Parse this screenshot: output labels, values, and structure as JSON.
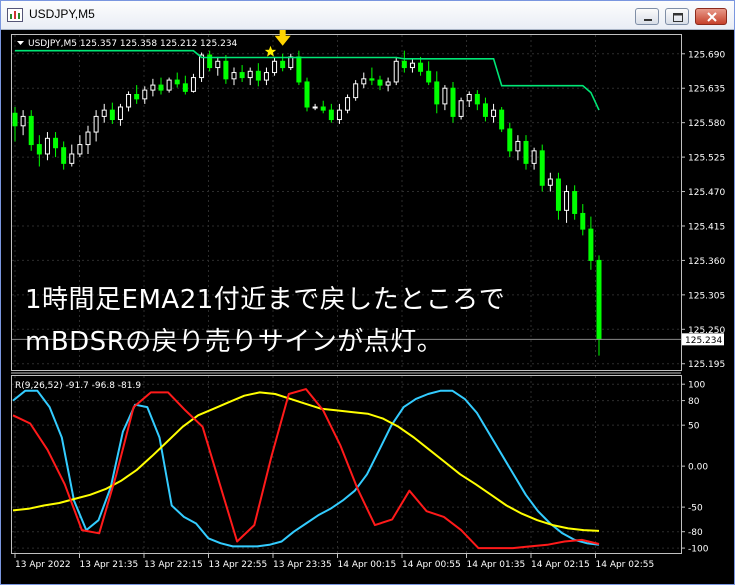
{
  "window": {
    "title": "USDJPY,M5"
  },
  "main_chart": {
    "header": "USDJPY,M5  125.357 125.358 125.212 125.234",
    "price_label": "125.234",
    "annotation_lines": [
      "1時間足EMA21付近まで戻したところで",
      "mBDSRの戻り売りサインが点灯。"
    ]
  },
  "indicator": {
    "header": "R(9,26,52) -91.7 -96.8 -81.9"
  },
  "time_labels": [
    "13 Apr 2022",
    "13 Apr 21:35",
    "13 Apr 22:15",
    "13 Apr 22:55",
    "13 Apr 23:35",
    "14 Apr 00:15",
    "14 Apr 00:55",
    "14 Apr 01:35",
    "14 Apr 02:15",
    "14 Apr 02:55"
  ],
  "colors": {
    "background": "#000000",
    "grid": "#2d2d2d",
    "bull": "#ffffff",
    "bear": "#00ff00",
    "ema": "#00e676",
    "signal_arrow": "#ffd400",
    "signal_star": "#ffee00",
    "r_fast": "#ff1a1a",
    "r_mid": "#33ccff",
    "r_slow": "#ffff00"
  },
  "chart_data": [
    {
      "type": "candlestick",
      "title": "USDJPY,M5",
      "y_ticks": [
        125.69,
        125.635,
        125.58,
        125.525,
        125.47,
        125.415,
        125.36,
        125.305,
        125.25,
        125.195
      ],
      "ylim": [
        125.185,
        125.72
      ],
      "last_price": 125.234,
      "candles": [
        [
          125.595,
          125.605,
          125.55,
          125.575
        ],
        [
          125.575,
          125.6,
          125.56,
          125.59
        ],
        [
          125.59,
          125.6,
          125.535,
          125.545
        ],
        [
          125.545,
          125.56,
          125.51,
          125.53
        ],
        [
          125.53,
          125.565,
          125.52,
          125.555
        ],
        [
          125.555,
          125.565,
          125.525,
          125.54
        ],
        [
          125.54,
          125.55,
          125.505,
          125.515
        ],
        [
          125.515,
          125.545,
          125.51,
          125.53
        ],
        [
          125.53,
          125.56,
          125.525,
          125.545
        ],
        [
          125.545,
          125.575,
          125.53,
          125.565
        ],
        [
          125.565,
          125.6,
          125.55,
          125.59
        ],
        [
          125.59,
          125.61,
          125.58,
          125.6
        ],
        [
          125.6,
          125.612,
          125.578,
          125.585
        ],
        [
          125.585,
          125.61,
          125.575,
          125.605
        ],
        [
          125.605,
          125.63,
          125.598,
          125.625
        ],
        [
          125.625,
          125.64,
          125.61,
          125.618
        ],
        [
          125.618,
          125.638,
          125.61,
          125.632
        ],
        [
          125.632,
          125.65,
          125.622,
          125.64
        ],
        [
          125.64,
          125.652,
          125.625,
          125.632
        ],
        [
          125.632,
          125.652,
          125.628,
          125.648
        ],
        [
          125.648,
          125.66,
          125.636,
          125.642
        ],
        [
          125.642,
          125.655,
          125.625,
          125.63
        ],
        [
          125.63,
          125.658,
          125.628,
          125.652
        ],
        [
          125.652,
          125.692,
          125.645,
          125.688
        ],
        [
          125.688,
          125.695,
          125.662,
          125.668
        ],
        [
          125.668,
          125.685,
          125.655,
          125.678
        ],
        [
          125.678,
          125.688,
          125.642,
          125.65
        ],
        [
          125.65,
          125.668,
          125.64,
          125.66
        ],
        [
          125.66,
          125.672,
          125.645,
          125.652
        ],
        [
          125.652,
          125.668,
          125.64,
          125.662
        ],
        [
          125.662,
          125.675,
          125.638,
          125.648
        ],
        [
          125.648,
          125.668,
          125.64,
          125.66
        ],
        [
          125.66,
          125.685,
          125.655,
          125.678
        ],
        [
          125.678,
          125.69,
          125.662,
          125.668
        ],
        [
          125.668,
          125.69,
          125.664,
          125.685
        ],
        [
          125.685,
          125.695,
          125.64,
          125.645
        ],
        [
          125.645,
          125.652,
          125.598,
          125.605
        ],
        [
          125.605,
          125.61,
          125.6,
          125.605
        ],
        [
          125.605,
          125.615,
          125.595,
          125.6
        ],
        [
          125.6,
          125.61,
          125.58,
          125.585
        ],
        [
          125.585,
          125.61,
          125.578,
          125.6
        ],
        [
          125.6,
          125.625,
          125.595,
          125.62
        ],
        [
          125.62,
          125.648,
          125.615,
          125.642
        ],
        [
          125.642,
          125.66,
          125.635,
          125.65
        ],
        [
          125.65,
          125.668,
          125.64,
          125.648
        ],
        [
          125.648,
          125.655,
          125.632,
          125.64
        ],
        [
          125.64,
          125.652,
          125.63,
          125.645
        ],
        [
          125.645,
          125.685,
          125.64,
          125.678
        ],
        [
          125.678,
          125.695,
          125.66,
          125.668
        ],
        [
          125.668,
          125.682,
          125.66,
          125.675
        ],
        [
          125.675,
          125.685,
          125.655,
          125.662
        ],
        [
          125.662,
          125.678,
          125.64,
          125.645
        ],
        [
          125.645,
          125.662,
          125.595,
          125.61
        ],
        [
          125.61,
          125.64,
          125.6,
          125.635
        ],
        [
          125.635,
          125.645,
          125.58,
          125.59
        ],
        [
          125.59,
          125.62,
          125.585,
          125.615
        ],
        [
          125.615,
          125.63,
          125.605,
          125.625
        ],
        [
          125.625,
          125.632,
          125.6,
          125.61
        ],
        [
          125.61,
          125.62,
          125.582,
          125.59
        ],
        [
          125.59,
          125.61,
          125.58,
          125.6
        ],
        [
          125.6,
          125.605,
          125.565,
          125.57
        ],
        [
          125.57,
          125.58,
          125.525,
          125.535
        ],
        [
          125.535,
          125.56,
          125.52,
          125.55
        ],
        [
          125.55,
          125.56,
          125.505,
          125.515
        ],
        [
          125.515,
          125.54,
          125.505,
          125.535
        ],
        [
          125.535,
          125.545,
          125.47,
          125.48
        ],
        [
          125.48,
          125.5,
          125.47,
          125.49
        ],
        [
          125.49,
          125.5,
          125.425,
          125.44
        ],
        [
          125.44,
          125.48,
          125.42,
          125.47
        ],
        [
          125.47,
          125.48,
          125.425,
          125.435
        ],
        [
          125.435,
          125.45,
          125.4,
          125.41
        ],
        [
          125.41,
          125.43,
          125.345,
          125.36
        ],
        [
          125.36,
          125.368,
          125.208,
          125.234
        ]
      ],
      "series": [
        {
          "name": "",
          "values": [
            125.695,
            125.695,
            125.695,
            125.695,
            125.695,
            125.695,
            125.695,
            125.695,
            125.695,
            125.695,
            125.695,
            125.695,
            125.695,
            125.695,
            125.695,
            125.695,
            125.695,
            125.695,
            125.695,
            125.695,
            125.695,
            125.695,
            125.695,
            125.684,
            125.684,
            125.684,
            125.684,
            125.684,
            125.684,
            125.684,
            125.684,
            125.684,
            125.684,
            125.684,
            125.684,
            125.684,
            125.684,
            125.684,
            125.684,
            125.684,
            125.684,
            125.684,
            125.684,
            125.684,
            125.684,
            125.684,
            125.684,
            125.684,
            125.682,
            125.682,
            125.682,
            125.682,
            125.682,
            125.682,
            125.682,
            125.682,
            125.682,
            125.682,
            125.682,
            125.682,
            125.639,
            125.639,
            125.639,
            125.639,
            125.639,
            125.639,
            125.639,
            125.639,
            125.639,
            125.639,
            125.639,
            125.628,
            125.6
          ]
        }
      ],
      "signal_index": 33
    },
    {
      "type": "line",
      "title": "R(9,26,52) -91.7 -96.8 -81.9",
      "y_ticks": [
        100,
        80,
        50,
        0,
        -50,
        -80,
        -100
      ],
      "y_tick_labels": [
        "100",
        "80",
        "50",
        "0.00",
        "-50",
        "-80",
        "-100"
      ],
      "ylim": [
        -106,
        110
      ],
      "series": [
        {
          "name": "",
          "values": [
            80,
            92,
            92,
            72,
            35,
            -42,
            -78,
            -66,
            -26,
            42,
            75,
            72,
            35,
            -48,
            -62,
            -70,
            -88,
            -94,
            -98,
            -98,
            -98,
            -96,
            -92,
            -80,
            -70,
            -60,
            -52,
            -42,
            -30,
            -10,
            20,
            50,
            72,
            82,
            88,
            92,
            92,
            82,
            65,
            40,
            15,
            -10,
            -35,
            -55,
            -70,
            -82,
            -90,
            -94,
            -96
          ]
        },
        {
          "name": "",
          "values": [
            62,
            52,
            20,
            -22,
            -78,
            -82,
            -10,
            72,
            90,
            90,
            68,
            48,
            -22,
            -92,
            -72,
            12,
            88,
            94,
            68,
            25,
            -28,
            -72,
            -65,
            -30,
            -55,
            -62,
            -78,
            -100,
            -100,
            -100,
            -98,
            -96,
            -92,
            -90,
            -95
          ]
        },
        {
          "name": "",
          "values": [
            -54,
            -52,
            -48,
            -45,
            -40,
            -35,
            -28,
            -18,
            -5,
            12,
            30,
            48,
            62,
            70,
            78,
            86,
            90,
            88,
            82,
            76,
            70,
            68,
            66,
            64,
            58,
            48,
            35,
            20,
            5,
            -10,
            -22,
            -35,
            -48,
            -58,
            -66,
            -72,
            -76,
            -78,
            -79
          ]
        }
      ]
    }
  ]
}
